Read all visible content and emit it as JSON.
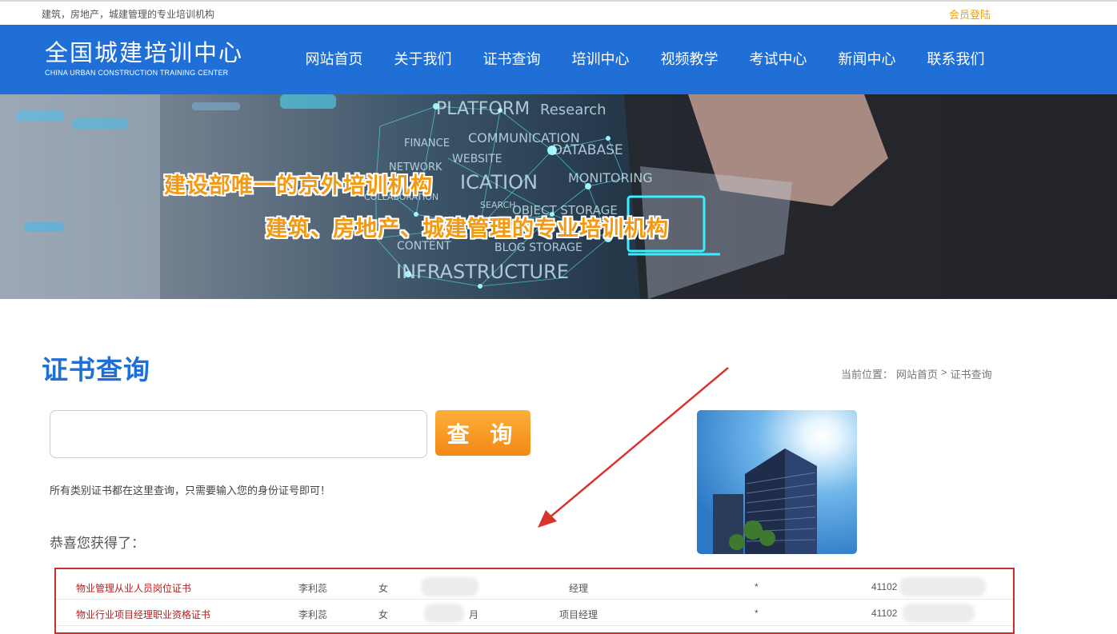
{
  "topbar": {
    "tagline": "建筑，房地产，城建管理的专业培训机构",
    "login": "会员登陆"
  },
  "logo": {
    "cn": "全国城建培训中心",
    "en": "CHINA URBAN CONSTRUCTION TRAINING CENTER"
  },
  "nav": [
    "网站首页",
    "关于我们",
    "证书查询",
    "培训中心",
    "视频教学",
    "考试中心",
    "新闻中心",
    "联系我们"
  ],
  "banner": {
    "slogan1": "建设部唯一的京外培训机构",
    "slogan2": "建筑、房地产、城建管理的专业培训机构",
    "words": [
      "PLATFORM",
      "Research",
      "COMMUNICATION",
      "FINANCE",
      "WEBSITE",
      "DATABASE",
      "NETWORK",
      "ICATION",
      "MONITORING",
      "COLLABORATION",
      "SEARCH",
      "OBJECT STORAGE",
      "CONTENT",
      "BLOG STORAGE",
      "INFRASTRUCTURE"
    ]
  },
  "page": {
    "title": "证书查询",
    "breadcrumb": {
      "prefix": "当前位置：",
      "home": "网站首页",
      "sep": ">",
      "current": "证书查询"
    }
  },
  "search": {
    "value": "",
    "placeholder": "",
    "button": "查 询"
  },
  "hint": "所有类别证书都在这里查询，只需要输入您的身份证号即可！",
  "congrats": "恭喜您获得了：",
  "results": [
    {
      "cert": "物业管理从业人员岗位证书",
      "name": "李利蕊",
      "gender": "女",
      "month": "",
      "position": "经理",
      "star": "*",
      "id": "41102"
    },
    {
      "cert": "物业行业项目经理职业资格证书",
      "name": "李利蕊",
      "gender": "女",
      "month": "月",
      "position": "项目经理",
      "star": "*",
      "id": "41102"
    }
  ],
  "colors": {
    "brand": "#1f6fd6",
    "accent": "#f39a14",
    "highlight": "#c9302c"
  }
}
